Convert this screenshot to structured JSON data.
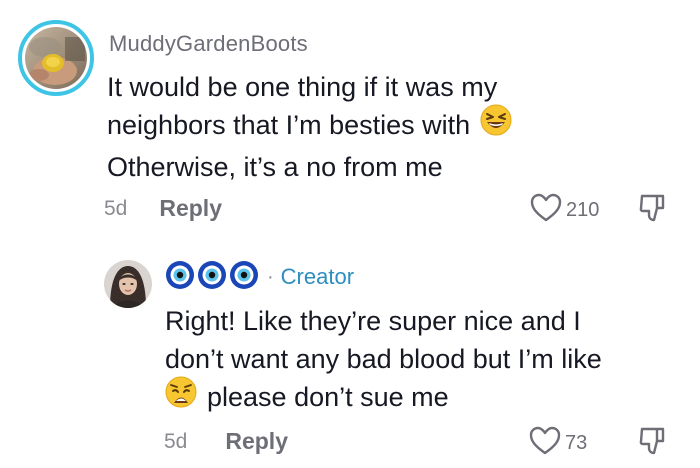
{
  "top_comment": {
    "username": "MuddyGardenBoots",
    "avatar_icon": "user-avatar-hand-holding-flower",
    "text_lines": [
      "It would be one thing if it was my",
      "neighbors that I’m besties with",
      "Otherwise, it’s a no from me"
    ],
    "emoji": "grinning-squinting-face",
    "date": "5d",
    "reply_label": "Reply",
    "like_count": "210",
    "like_icon": "heart-outline-icon",
    "dislike_icon": "thumbs-down-icon",
    "ring_color": "#3ec5e6"
  },
  "reply_comment": {
    "avatar_icon": "user-avatar-woman",
    "display_name_icons": [
      "evil-eye-icon",
      "evil-eye-icon",
      "evil-eye-icon"
    ],
    "separator": "·",
    "badge": "Creator",
    "badge_color": "#2d8fc0",
    "text_lines": [
      "Right! Like they’re super nice and I",
      "don’t want any bad blood but I’m like",
      "please don’t sue me"
    ],
    "emoji": "weary-face",
    "date": "5d",
    "reply_label": "Reply",
    "like_count": "73",
    "like_icon": "heart-outline-icon",
    "dislike_icon": "thumbs-down-icon"
  }
}
